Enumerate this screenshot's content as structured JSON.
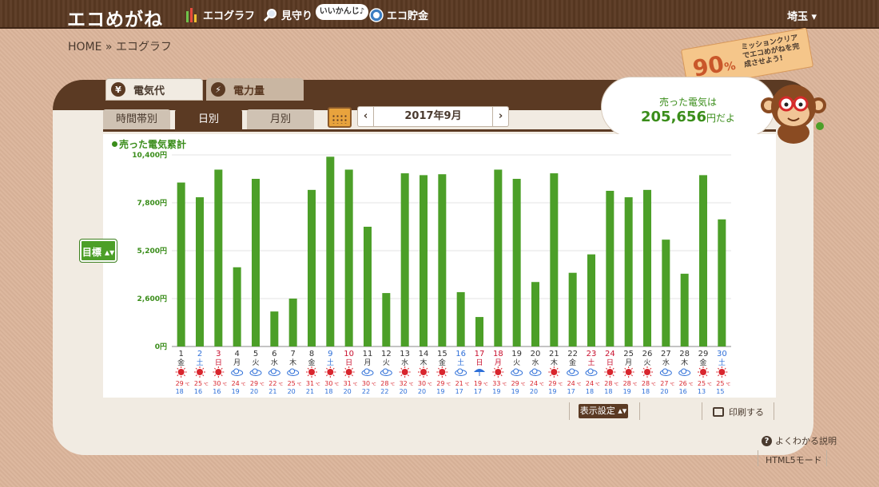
{
  "header": {
    "logo": "エコめがね",
    "nav": [
      {
        "label": "エコグラフ",
        "icon": "bar-graph-icon"
      },
      {
        "label": "見守り",
        "icon": "magnifier-icon"
      },
      {
        "label": "エコ貯金",
        "icon": "piggy-coin-icon"
      }
    ],
    "nav_bubble": "いいかんじ♪",
    "region": "埼玉 ▾"
  },
  "breadcrumb": "HOME » エコグラフ",
  "tabs_top": [
    {
      "label": "電気代",
      "icon": "¥"
    },
    {
      "label": "電力量",
      "icon": "⚡"
    }
  ],
  "subtabs": [
    "時間帯別",
    "日別",
    "月別"
  ],
  "date_nav": {
    "prev": "‹",
    "label": "2017年9月",
    "next": "›"
  },
  "mission_tag": {
    "percent": "90",
    "unit": "%",
    "text": "ミッションクリアでエコめがねを完成させよう!"
  },
  "speech": {
    "line1": "売った電気は",
    "amount": "205,656",
    "unit": "円だよ"
  },
  "legend": "売った電気累計",
  "goal_button": "目標 ▴▾",
  "display_settings": "表示設定 ▴▾",
  "print_label": "印刷する",
  "help_label": "よくわかる説明",
  "html5_label": "HTML5モード",
  "colors": {
    "bar": "#4c9f28",
    "saturday": "#2e6fd8",
    "sunday": "#c8102e",
    "brown": "#5b3a23"
  },
  "chart_data": {
    "type": "bar",
    "title": "",
    "ylabel": "",
    "ylim": [
      0,
      10400
    ],
    "yticks": [
      "0円",
      "2,600円",
      "5,200円",
      "7,800円",
      "10,400円"
    ],
    "days": [
      "1",
      "2",
      "3",
      "4",
      "5",
      "6",
      "7",
      "8",
      "9",
      "10",
      "11",
      "12",
      "13",
      "14",
      "15",
      "16",
      "17",
      "18",
      "19",
      "20",
      "21",
      "22",
      "23",
      "24",
      "25",
      "26",
      "27",
      "28",
      "29",
      "30"
    ],
    "weekdays": [
      "金",
      "土",
      "日",
      "月",
      "火",
      "水",
      "木",
      "金",
      "土",
      "日",
      "月",
      "火",
      "水",
      "木",
      "金",
      "土",
      "日",
      "月",
      "火",
      "水",
      "木",
      "金",
      "土",
      "日",
      "月",
      "火",
      "水",
      "木",
      "金",
      "土"
    ],
    "day_types": [
      "w",
      "sat",
      "sun",
      "w",
      "w",
      "w",
      "w",
      "w",
      "sat",
      "sun",
      "w",
      "w",
      "w",
      "w",
      "w",
      "sat",
      "sun",
      "hol",
      "w",
      "w",
      "w",
      "w",
      "hol",
      "sun",
      "w",
      "w",
      "w",
      "w",
      "w",
      "sat"
    ],
    "weather": [
      "sun",
      "sun",
      "sun",
      "cloud",
      "cloud",
      "cloud",
      "cloud",
      "sun",
      "sun",
      "sun",
      "cloud",
      "cloud",
      "sun",
      "sun",
      "sun",
      "cloud",
      "rain",
      "sun",
      "cloud",
      "cloud",
      "sun",
      "cloud",
      "cloud",
      "sun",
      "sun",
      "sun",
      "cloud",
      "cloud",
      "sun",
      "sun"
    ],
    "max_temp": [
      "29",
      "25",
      "30",
      "24",
      "29",
      "22",
      "25",
      "31",
      "30",
      "31",
      "30",
      "28",
      "32",
      "30",
      "29",
      "21",
      "19",
      "33",
      "29",
      "24",
      "29",
      "24",
      "24",
      "28",
      "28",
      "28",
      "27",
      "26",
      "25",
      "25"
    ],
    "min_temp": [
      "18",
      "16",
      "16",
      "19",
      "20",
      "21",
      "20",
      "21",
      "18",
      "20",
      "22",
      "22",
      "20",
      "20",
      "19",
      "17",
      "17",
      "19",
      "19",
      "20",
      "19",
      "17",
      "18",
      "18",
      "19",
      "18",
      "20",
      "16",
      "13",
      "15"
    ],
    "values": [
      8900,
      8100,
      9600,
      4300,
      9100,
      1900,
      2600,
      8500,
      10300,
      9600,
      6500,
      2900,
      9400,
      9300,
      9350,
      2950,
      1600,
      9600,
      9100,
      3500,
      9400,
      4000,
      5000,
      8450,
      8100,
      8500,
      5800,
      3950,
      9300,
      6900
    ]
  }
}
